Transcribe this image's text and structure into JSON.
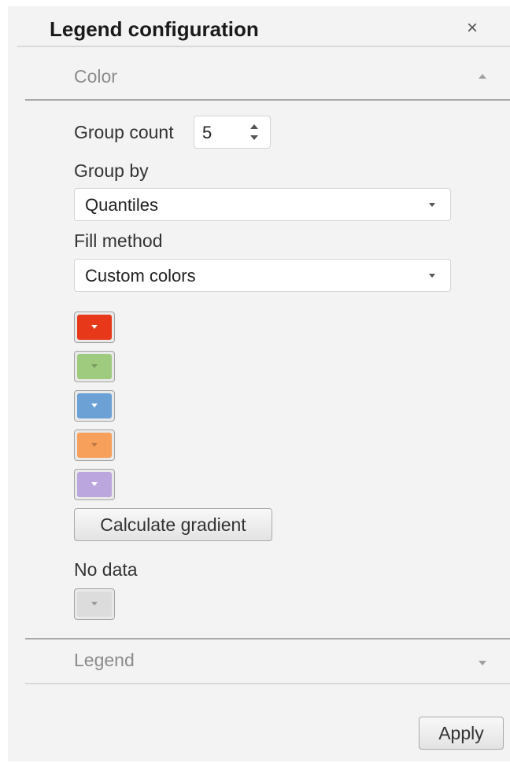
{
  "panel": {
    "title": "Legend configuration",
    "close_symbol": "×"
  },
  "color_section": {
    "header": "Color",
    "expanded": true,
    "group_count_label": "Group count",
    "group_count_value": "5",
    "group_by_label": "Group by",
    "group_by_value": "Quantiles",
    "fill_method_label": "Fill method",
    "fill_method_value": "Custom colors",
    "swatches": [
      {
        "name": "color-1",
        "color": "#e8381a",
        "arrow": "#ffffff"
      },
      {
        "name": "color-2",
        "color": "#9ecb7d",
        "arrow": "#7a9d62"
      },
      {
        "name": "color-3",
        "color": "#6ba1d4",
        "arrow": "#ffffff"
      },
      {
        "name": "color-4",
        "color": "#f7a05b",
        "arrow": "#b97845"
      },
      {
        "name": "color-5",
        "color": "#bba6de",
        "arrow": "#ffffff"
      }
    ],
    "calculate_gradient_label": "Calculate gradient",
    "no_data_label": "No data",
    "no_data_swatch": {
      "color": "#dcdcdc",
      "arrow": "#9a9a9a"
    }
  },
  "legend_section": {
    "header": "Legend",
    "expanded": false
  },
  "footer": {
    "apply_label": "Apply"
  }
}
